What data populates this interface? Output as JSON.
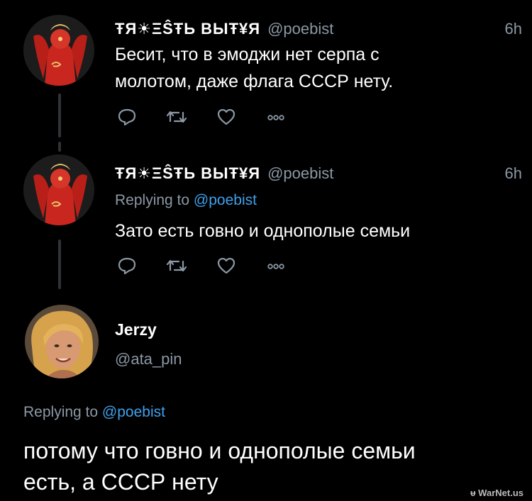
{
  "tweets": [
    {
      "display_name": "ŦЯ☀ΞŜŦЬ ВЫŦ¥Я",
      "handle": "@poebist",
      "time": "6h",
      "text_lines": [
        "Бесит, что в эмоджи нет серпа с",
        "молотом, даже флага СССР нету."
      ],
      "avatar": "red-soviet-art-avatar",
      "actions": [
        "reply-icon",
        "retweet-icon",
        "like-icon",
        "more-icon"
      ]
    },
    {
      "display_name": "ŦЯ☀ΞŜŦЬ ВЫŦ¥Я",
      "handle": "@poebist",
      "time": "6h",
      "replying_label": "Replying to",
      "replying_to": "@poebist",
      "text_lines": [
        "Зато есть говно и однополые семьи"
      ],
      "avatar": "red-soviet-art-avatar",
      "actions": [
        "reply-icon",
        "retweet-icon",
        "like-icon",
        "more-icon"
      ]
    }
  ],
  "focused_tweet": {
    "display_name": "Jerzy",
    "handle": "@ata_pin",
    "replying_label": "Replying to",
    "replying_to": "@poebist",
    "text_lines": [
      "потому что говно и однополые семьи",
      "есть, а СССР нету"
    ],
    "avatar": "blonde-man-photo-avatar"
  },
  "watermark": "ᵾ WarNet.us",
  "colors": {
    "background": "#000000",
    "secondary_text": "#8b98a5",
    "link": "#3fa0ec",
    "thread_line": "#2f3336",
    "avatar_red": "#c8261e"
  }
}
